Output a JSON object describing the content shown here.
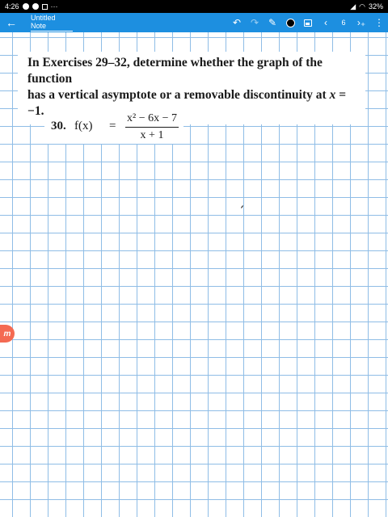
{
  "status_bar": {
    "time": "4:26",
    "more": "···",
    "battery": "32%"
  },
  "toolbar": {
    "title": "Untitled Note",
    "page_number": "6",
    "icons": [
      "back-arrow-icon",
      "undo-icon",
      "redo-icon",
      "pen-icon",
      "color-swatch",
      "image-icon",
      "prev-page-icon",
      "next-page-add-icon",
      "more-vert-icon"
    ],
    "pen_color": "#000000",
    "accent_color": "#1d8fe0"
  },
  "content": {
    "instructions_line1": "In Exercises 29–32, determine whether the graph of the function",
    "instructions_line2_prefix": "has a vertical asymptote or a removable discontinuity at ",
    "instructions_var": "x",
    "instructions_value": " = −1.",
    "exercise_number": "30.",
    "function_name": "f(x)",
    "equals": "=",
    "numerator": "x² − 6x − 7",
    "denominator": "x + 1"
  },
  "side_badge": {
    "letter": "m"
  }
}
